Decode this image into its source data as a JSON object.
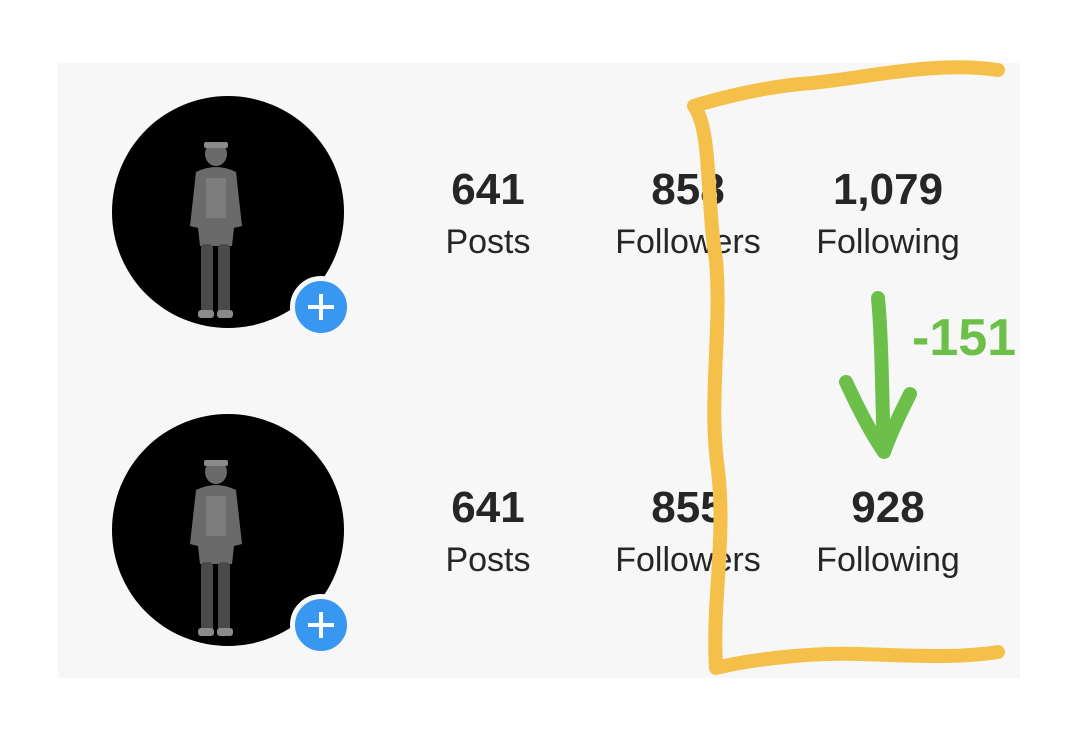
{
  "profiles": [
    {
      "posts": {
        "count": "641",
        "label": "Posts"
      },
      "followers": {
        "count": "858",
        "label": "Followers"
      },
      "following": {
        "count": "1,079",
        "label": "Following"
      }
    },
    {
      "posts": {
        "count": "641",
        "label": "Posts"
      },
      "followers": {
        "count": "855",
        "label": "Followers"
      },
      "following": {
        "count": "928",
        "label": "Following"
      }
    }
  ],
  "annotation": {
    "difference": "-151",
    "arrow_color": "#6cc04a",
    "bracket_color": "#f5c04a"
  },
  "colors": {
    "add_button": "#3897f0",
    "text": "#262626",
    "panel_bg": "#f7f7f7"
  },
  "icons": {
    "add_story": "plus-icon",
    "arrow": "arrow-down-icon"
  }
}
